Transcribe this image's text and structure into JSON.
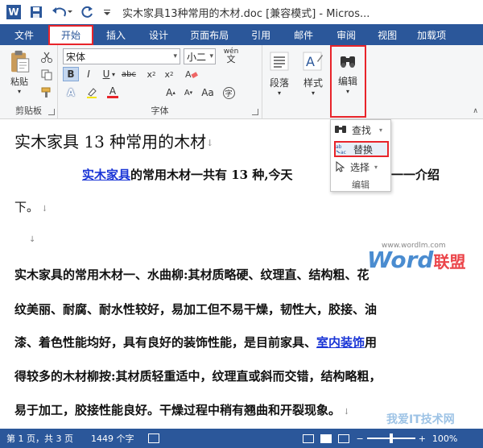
{
  "window": {
    "title": "实木家具13种常用的木材.doc [兼容模式] - Micros..."
  },
  "tabs": [
    "文件",
    "开始",
    "插入",
    "设计",
    "页面布局",
    "引用",
    "邮件",
    "审阅",
    "视图",
    "加载项"
  ],
  "ribbon": {
    "clipboard": {
      "paste_label": "粘贴",
      "group_label": "剪贴板"
    },
    "font": {
      "font_name": "宋体",
      "font_size": "小二",
      "wen_label": "wén",
      "group_label": "字体"
    },
    "paragraph": {
      "label": "段落"
    },
    "styles": {
      "label": "样式"
    },
    "editing": {
      "label": "编辑"
    }
  },
  "dropdown": {
    "find": "查找",
    "replace": "替换",
    "select": "选择",
    "group_label": "编辑"
  },
  "document": {
    "heading": "实木家具 13 种常用的木材",
    "p1_link": "实木家具",
    "p1_rest": "的常用木材一共有 13 种,今天",
    "p1_tail": "一一介绍",
    "p1_line2": "下。",
    "p2_l1_a": "实木家具的常用木材一、水曲柳:其材质略硬、纹理直、结构粗、花",
    "p2_l2": "纹美丽、耐腐、耐水性较好，易加工但不易干燥，韧性大，胶接、油",
    "p2_l3_a": "漆、着色性能均好，具有良好的装饰性能，是目前家具、",
    "p2_l3_link": "室内装饰",
    "p2_l3_b": "用",
    "p2_l4": "得较多的木材柳按:其材质轻重适中，纹理直或斜而交错，结构略粗，",
    "p2_l5": "易于加工，胶接性能良好。干燥过程中稍有翘曲和开裂现象。"
  },
  "watermark": {
    "url": "www.wordlm.com",
    "word": "Word",
    "union": "联盟",
    "site": "我爱IT技术网"
  },
  "status": {
    "page": "第 1 页，共 3 页",
    "words": "1449 个字",
    "zoom": "100%"
  },
  "colors": {
    "accent": "#2b579a",
    "highlight_box": "#e8242a",
    "link": "#1a35d6"
  }
}
